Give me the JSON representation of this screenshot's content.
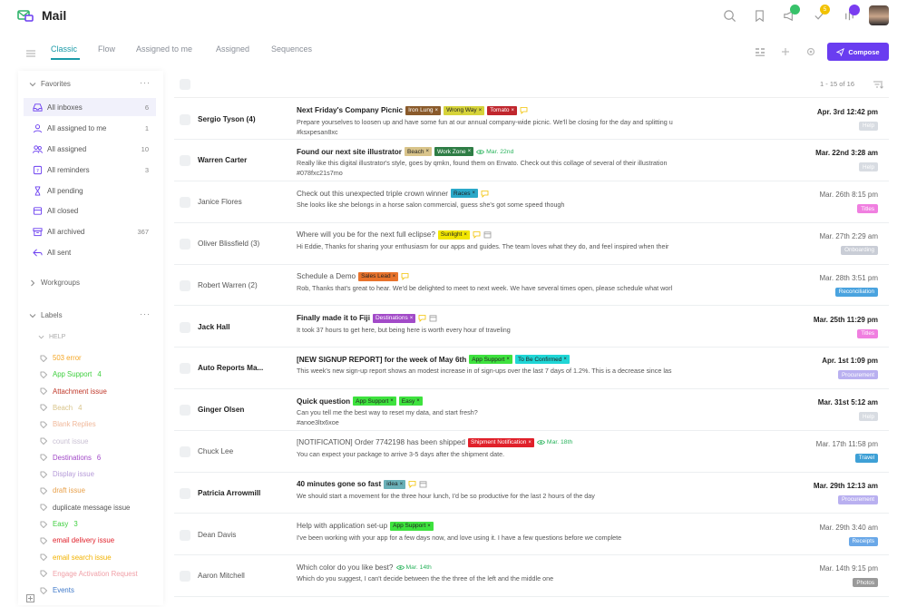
{
  "app": {
    "title": "Mail"
  },
  "tabs": [
    {
      "label": "Classic",
      "active": true
    },
    {
      "label": "Flow"
    },
    {
      "label": "Assigned to me"
    },
    {
      "label": "Assigned"
    },
    {
      "label": "Sequences"
    }
  ],
  "notifications": {
    "badge_count": "5"
  },
  "compose_label": "Compose",
  "sidebar": {
    "favorites_label": "Favorites",
    "favorites_menu": "···",
    "items": [
      {
        "label": "All inboxes",
        "count": "6",
        "icon": "inbox-icon"
      },
      {
        "label": "All assigned to me",
        "count": "1",
        "icon": "assigned-to-me-icon"
      },
      {
        "label": "All assigned",
        "count": "10",
        "icon": "assigned-icon"
      },
      {
        "label": "All reminders",
        "count": "3",
        "icon": "reminder-icon"
      },
      {
        "label": "All pending",
        "count": "",
        "icon": "hourglass-icon"
      },
      {
        "label": "All closed",
        "count": "",
        "icon": "closed-icon"
      },
      {
        "label": "All archived",
        "count": "367",
        "icon": "archive-icon"
      },
      {
        "label": "All sent",
        "count": "",
        "icon": "sent-icon"
      }
    ],
    "workgroups_label": "Workgroups",
    "labels_label": "Labels",
    "labels_menu": "···",
    "help_group": "HELP",
    "labels": [
      {
        "label": "503 error",
        "count": "",
        "color": "#f5a623"
      },
      {
        "label": "App Support",
        "count": "4",
        "color": "#3ecf3e"
      },
      {
        "label": "Attachment issue",
        "count": "",
        "color": "#c0392b"
      },
      {
        "label": "Beach",
        "count": "4",
        "color": "#d9c48a"
      },
      {
        "label": "Blank Replies",
        "count": "",
        "color": "#f0b89a"
      },
      {
        "label": "count issue",
        "count": "",
        "color": "#c9c0d3"
      },
      {
        "label": "Destinations",
        "count": "6",
        "color": "#a24ac8"
      },
      {
        "label": "Display issue",
        "count": "",
        "color": "#b59ad8"
      },
      {
        "label": "draft issue",
        "count": "",
        "color": "#e8a04a"
      },
      {
        "label": "duplicate message issue",
        "count": "",
        "color": "#555555"
      },
      {
        "label": "Easy",
        "count": "3",
        "color": "#3ecf3e"
      },
      {
        "label": "email delivery issue",
        "count": "",
        "color": "#e0202a"
      },
      {
        "label": "email search issue",
        "count": "",
        "color": "#f2b200"
      },
      {
        "label": "Engage Activation Request",
        "count": "",
        "color": "#f0a0a8"
      },
      {
        "label": "Events",
        "count": "",
        "color": "#3e78c9"
      }
    ]
  },
  "list": {
    "pager": "1 - 15 of 16",
    "rows": [
      {
        "sender": "Sergio Tyson",
        "count": "(4)",
        "unread": true,
        "subject": "Next Friday's Company Picnic",
        "tags": [
          {
            "label": "Iron Lung",
            "bg": "#8a5a2b",
            "fg": "#ffffff"
          },
          {
            "label": "Wrong Way",
            "bg": "#d6d33a",
            "fg": "#222222"
          },
          {
            "label": "Tomato",
            "bg": "#c0262d",
            "fg": "#ffffff"
          }
        ],
        "extra": "",
        "snippet": "Prepare yourselves to loosen up and have some fun at our annual company-wide picnic. We'll be closing for the day and splitting u",
        "snippet2": "#ksxpesan8xc",
        "date": "Apr. 3rd 12:42 pm",
        "category": "Help",
        "category_color": "#d8dce2"
      },
      {
        "sender": "Warren Carter",
        "count": "",
        "unread": true,
        "subject": "Found our next site illustrator",
        "tags": [
          {
            "label": "Beach",
            "bg": "#d9c48a",
            "fg": "#222222"
          },
          {
            "label": "Work Zone",
            "bg": "#2e7d45",
            "fg": "#ffffff"
          }
        ],
        "extra": "Mar. 22nd",
        "snippet": "Really like this digital illustrator's style, goes by qmkn, found them on Envato. Check out this collage of several of their illustration",
        "snippet2": "#078fxc21s7mo",
        "date": "Mar. 22nd 3:28 am",
        "category": "Help",
        "category_color": "#d8dce2"
      },
      {
        "sender": "Janice Flores",
        "count": "",
        "unread": false,
        "subject": "Check out this unexpected triple crown winner",
        "tags": [
          {
            "label": "Races",
            "bg": "#2aa8c9",
            "fg": "#222222"
          }
        ],
        "extra": "",
        "snippet": "She looks like she belongs in a horse salon commercial, guess she's got some speed though",
        "snippet2": "",
        "date": "Mar. 26th 8:15 pm",
        "category": "Titles",
        "category_color": "#f07fe0"
      },
      {
        "sender": "Oliver Blissfield",
        "count": "(3)",
        "unread": false,
        "subject": "Where will you be for the next full eclipse?",
        "tags": [
          {
            "label": "Sunlight",
            "bg": "#f2e600",
            "fg": "#222222"
          }
        ],
        "extra": "",
        "snippet": "Hi Eddie, Thanks for sharing your enthusiasm for our apps and guides. The team loves what they do, and feel inspired when their",
        "snippet2": "",
        "date": "Mar. 27th 2:29 am",
        "category": "Onboarding",
        "category_color": "#c9cdd6"
      },
      {
        "sender": "Robert Warren",
        "count": "(2)",
        "unread": false,
        "subject": "Schedule a Demo",
        "tags": [
          {
            "label": "Sales Lead",
            "bg": "#e8732c",
            "fg": "#222222"
          }
        ],
        "extra": "",
        "snippet": "Rob, Thanks that's great to hear. We'd be delighted to meet to next week. We have several times open, please schedule what worl",
        "snippet2": "",
        "date": "Mar. 28th 3:51 pm",
        "category": "Reconciliation",
        "category_color": "#4aa3df"
      },
      {
        "sender": "Jack Hall",
        "count": "",
        "unread": true,
        "subject": "Finally made it to Fiji",
        "tags": [
          {
            "label": "Destinations",
            "bg": "#a24ac8",
            "fg": "#ffffff"
          }
        ],
        "extra": "",
        "snippet": "It took 37 hours to get here, but being here is worth every hour of traveling",
        "snippet2": "",
        "date": "Mar. 25th 11:29 pm",
        "category": "Titles",
        "category_color": "#f07fe0"
      },
      {
        "sender": "Auto Reports Ma...",
        "count": "",
        "unread": true,
        "subject": "[NEW SIGNUP REPORT] for the week of May 6th",
        "tags": [
          {
            "label": "App Support",
            "bg": "#3ee23e",
            "fg": "#222222"
          },
          {
            "label": "To Be Confirmed",
            "bg": "#20d6d6",
            "fg": "#222222"
          }
        ],
        "extra": "",
        "snippet": "This week's new sign-up report shows an modest increase in of sign-ups over the last 7 days of 1.2%. This is a decrease since las",
        "snippet2": "",
        "date": "Apr. 1st 1:09 pm",
        "category": "Procurement",
        "category_color": "#b9b0f0"
      },
      {
        "sender": "Ginger Olsen",
        "count": "",
        "unread": true,
        "subject": "Quick question",
        "tags": [
          {
            "label": "App Support",
            "bg": "#3ee23e",
            "fg": "#222222"
          },
          {
            "label": "Easy",
            "bg": "#3ee23e",
            "fg": "#222222"
          }
        ],
        "extra": "",
        "snippet": "Can you tell me the best way to reset my data, and start fresh?",
        "snippet2": "#anoe3ltx6xoe",
        "date": "Mar. 31st 5:12 am",
        "category": "Help",
        "category_color": "#d8dce2"
      },
      {
        "sender": "Chuck Lee",
        "count": "",
        "unread": false,
        "subject": "[NOTIFICATION] Order 7742198 has been shipped",
        "tags": [
          {
            "label": "Shipment Notification",
            "bg": "#e0202a",
            "fg": "#ffffff"
          }
        ],
        "extra": "Mar. 18th",
        "snippet": "You can expect your package to arrive 3-5 days after the shipment date.",
        "snippet2": "",
        "date": "Mar. 17th 11:58 pm",
        "category": "Travel",
        "category_color": "#3ea0d6"
      },
      {
        "sender": "Patricia Arrowmill",
        "count": "",
        "unread": true,
        "subject": "40 minutes gone so fast",
        "tags": [
          {
            "label": "idea",
            "bg": "#6ab0b8",
            "fg": "#222222"
          }
        ],
        "extra": "",
        "snippet": "We should start a movement for the three hour lunch, I'd be so productive for the last 2 hours of the day",
        "snippet2": "",
        "date": "Mar. 29th 12:13 am",
        "category": "Procurement",
        "category_color": "#b9b0f0"
      },
      {
        "sender": "Dean Davis",
        "count": "",
        "unread": false,
        "subject": "Help with application set-up",
        "tags": [
          {
            "label": "App Support",
            "bg": "#3ee23e",
            "fg": "#222222"
          }
        ],
        "extra": "",
        "snippet": "I've been working with your app for a few days now, and love using it. I have a few questions before we complete",
        "snippet2": "",
        "date": "Mar. 29th 3:40 am",
        "category": "Receipts",
        "category_color": "#6aa8e8"
      },
      {
        "sender": "Aaron Mitchell",
        "count": "",
        "unread": false,
        "subject": "Which color do you like best?",
        "tags": [],
        "extra": "Mar. 14th",
        "snippet": "Which do you suggest, I can't decide between the the three of the left and the middle one",
        "snippet2": "",
        "date": "Mar. 14th 9:15 pm",
        "category": "Photos",
        "category_color": "#9a9a9a"
      }
    ]
  }
}
